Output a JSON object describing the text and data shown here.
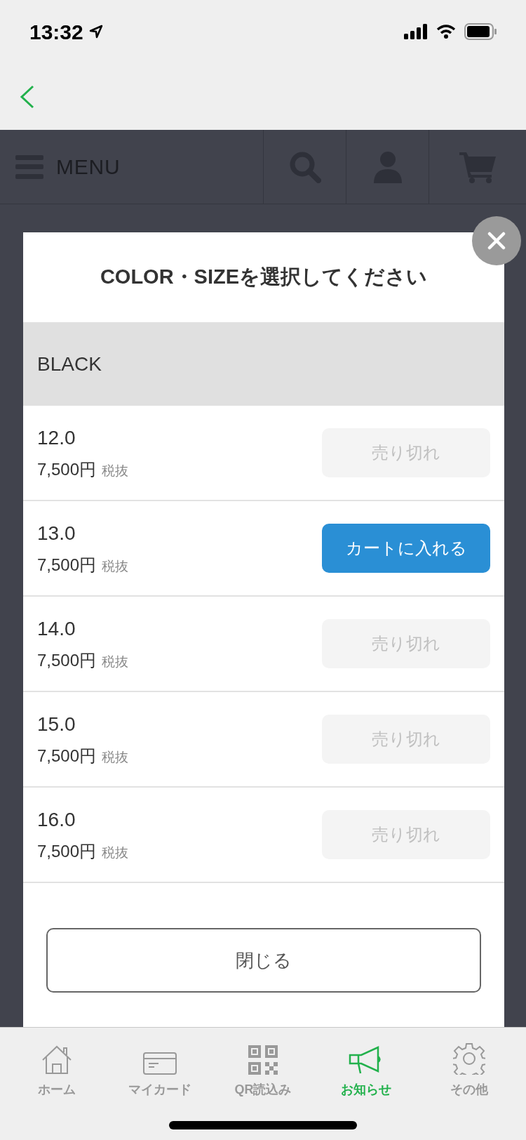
{
  "status_bar": {
    "time": "13:32"
  },
  "site_header": {
    "menu_label": "MENU"
  },
  "modal": {
    "title": "COLOR・SIZEを選択してください",
    "group": "BLACK",
    "items": [
      {
        "size": "12.0",
        "price": "7,500円",
        "tax": "税抜",
        "action": "売り切れ",
        "disabled": true
      },
      {
        "size": "13.0",
        "price": "7,500円",
        "tax": "税抜",
        "action": "カートに入れる",
        "disabled": false
      },
      {
        "size": "14.0",
        "price": "7,500円",
        "tax": "税抜",
        "action": "売り切れ",
        "disabled": true
      },
      {
        "size": "15.0",
        "price": "7,500円",
        "tax": "税抜",
        "action": "売り切れ",
        "disabled": true
      },
      {
        "size": "16.0",
        "price": "7,500円",
        "tax": "税抜",
        "action": "売り切れ",
        "disabled": true
      }
    ],
    "close_button": "閉じる"
  },
  "tab_bar": [
    {
      "kind": "home",
      "label": "ホーム",
      "selected": false
    },
    {
      "kind": "card",
      "label": "マイカード",
      "selected": false
    },
    {
      "kind": "qr",
      "label": "QR読込み",
      "selected": false
    },
    {
      "kind": "news",
      "label": "お知らせ",
      "selected": true
    },
    {
      "kind": "settings",
      "label": "その他",
      "selected": false
    }
  ]
}
